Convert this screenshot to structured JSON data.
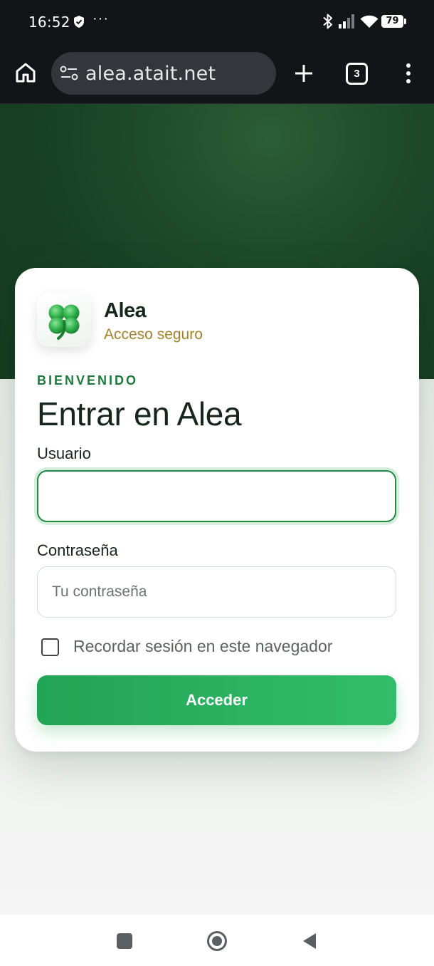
{
  "status_bar": {
    "time": "16:52",
    "battery": "79",
    "icons": [
      "shield-icon",
      "more-dots-icon",
      "bluetooth-icon",
      "signal-icon",
      "wifi-icon",
      "battery-icon"
    ]
  },
  "browser": {
    "url": "alea.atait.net",
    "tab_count": "3",
    "icons": [
      "home-icon",
      "site-info-icon",
      "plus-icon",
      "tabs-icon",
      "kebab-menu-icon"
    ]
  },
  "login": {
    "brand_name": "Alea",
    "brand_subtitle": "Acceso seguro",
    "logo_icon": "four-leaf-clover-icon",
    "eyebrow": "BIENVENIDO",
    "heading": "Entrar en Alea",
    "username_label": "Usuario",
    "username_value": "",
    "username_placeholder": "",
    "password_label": "Contraseña",
    "password_placeholder": "Tu contraseña",
    "remember_label": "Recordar sesión en este navegador",
    "remember_checked": false,
    "submit_label": "Acceder"
  },
  "colors": {
    "hero_green": "#1f4d2b",
    "accent_green": "#22a355",
    "eyebrow_green": "#1c7a3c",
    "gold": "#a2822a"
  },
  "nav_bar": {
    "icons": [
      "recents-icon",
      "home-circle-icon",
      "back-triangle-icon"
    ]
  }
}
